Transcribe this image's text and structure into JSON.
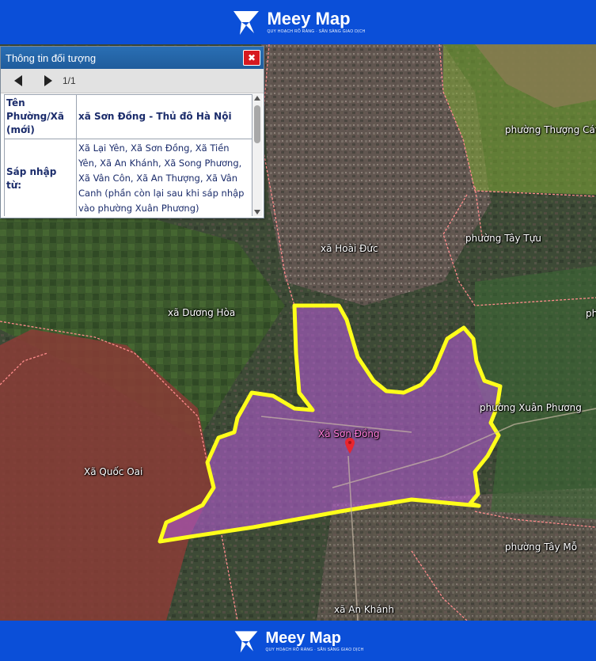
{
  "brand": {
    "name": "Meey Map",
    "tagline": "QUY HOẠCH RÕ RÀNG · SẴN SÀNG GIAO DỊCH"
  },
  "panel": {
    "title": "Thông tin đối tượng",
    "close_icon": "close-icon",
    "page_counter": "1/1",
    "rows": [
      {
        "label": "Tên Phường/Xã (mới)",
        "value": "xã Sơn Đồng - Thủ đô Hà Nội"
      },
      {
        "label": "Sáp nhập từ:",
        "value": "Xã Lại Yên, Xã Sơn Đồng, Xã Tiền Yên, Xã An Khánh, Xã Song Phương, Xã Vân Côn, Xã An Thượng, Xã Vân Canh (phần còn lại sau khi sáp nhập vào phường Xuân Phương)"
      }
    ]
  },
  "map": {
    "labels": {
      "thuong_cat": "phường Thượng Cát",
      "tay_tuu": "phường Tây Tựu",
      "hoai_duc": "xã Hoài Đức",
      "duong_hoa": "xã Dương Hòa",
      "son_dong": "Xã Sơn Đồng",
      "xuan_phuong": "phường Xuân Phương",
      "quoc_oai": "Xã Quốc Oai",
      "tay_mo": "phường Tây Mỗ",
      "an_khanh": "xã An Khánh",
      "edge_ph": "ph"
    },
    "colors": {
      "selected_boundary": "#ffff1a",
      "selected_fill": "#b05ad0",
      "admin_boundary": "#ff8c8c",
      "west_zone_tint": "#b44c4c",
      "north_zone_tint": "#8fbf3a",
      "marker": "#e8252f"
    }
  }
}
